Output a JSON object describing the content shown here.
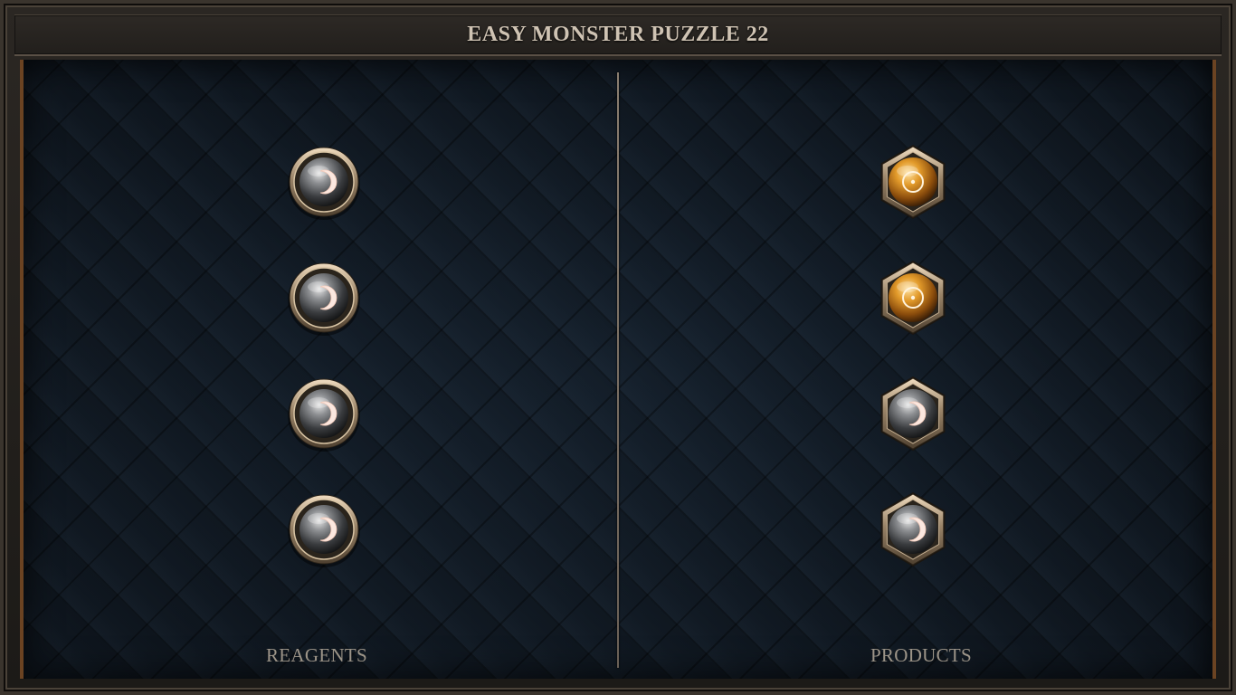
{
  "title": "EASY MONSTER PUZZLE 22",
  "panels": {
    "left_label": "REAGENTS",
    "right_label": "PRODUCTS"
  },
  "reagents": [
    {
      "icon": "moon-rune-icon",
      "shape": "round",
      "orb_color": "#5a5c5e"
    },
    {
      "icon": "moon-rune-icon",
      "shape": "round",
      "orb_color": "#5a5c5e"
    },
    {
      "icon": "moon-rune-icon",
      "shape": "round",
      "orb_color": "#5a5c5e"
    },
    {
      "icon": "moon-rune-icon",
      "shape": "round",
      "orb_color": "#5a5c5e"
    }
  ],
  "products": [
    {
      "icon": "sun-rune-icon",
      "shape": "hexagon",
      "orb_color": "#c77a1a"
    },
    {
      "icon": "sun-rune-icon",
      "shape": "hexagon",
      "orb_color": "#c77a1a"
    },
    {
      "icon": "moon-rune-icon",
      "shape": "hexagon",
      "orb_color": "#5a5c5e"
    },
    {
      "icon": "moon-rune-icon",
      "shape": "hexagon",
      "orb_color": "#5a5c5e"
    }
  ],
  "colors": {
    "board_bg": "#111a24",
    "border_accent": "#6b4322",
    "title_text": "#cfc3b3",
    "label_text": "#9c9488"
  }
}
